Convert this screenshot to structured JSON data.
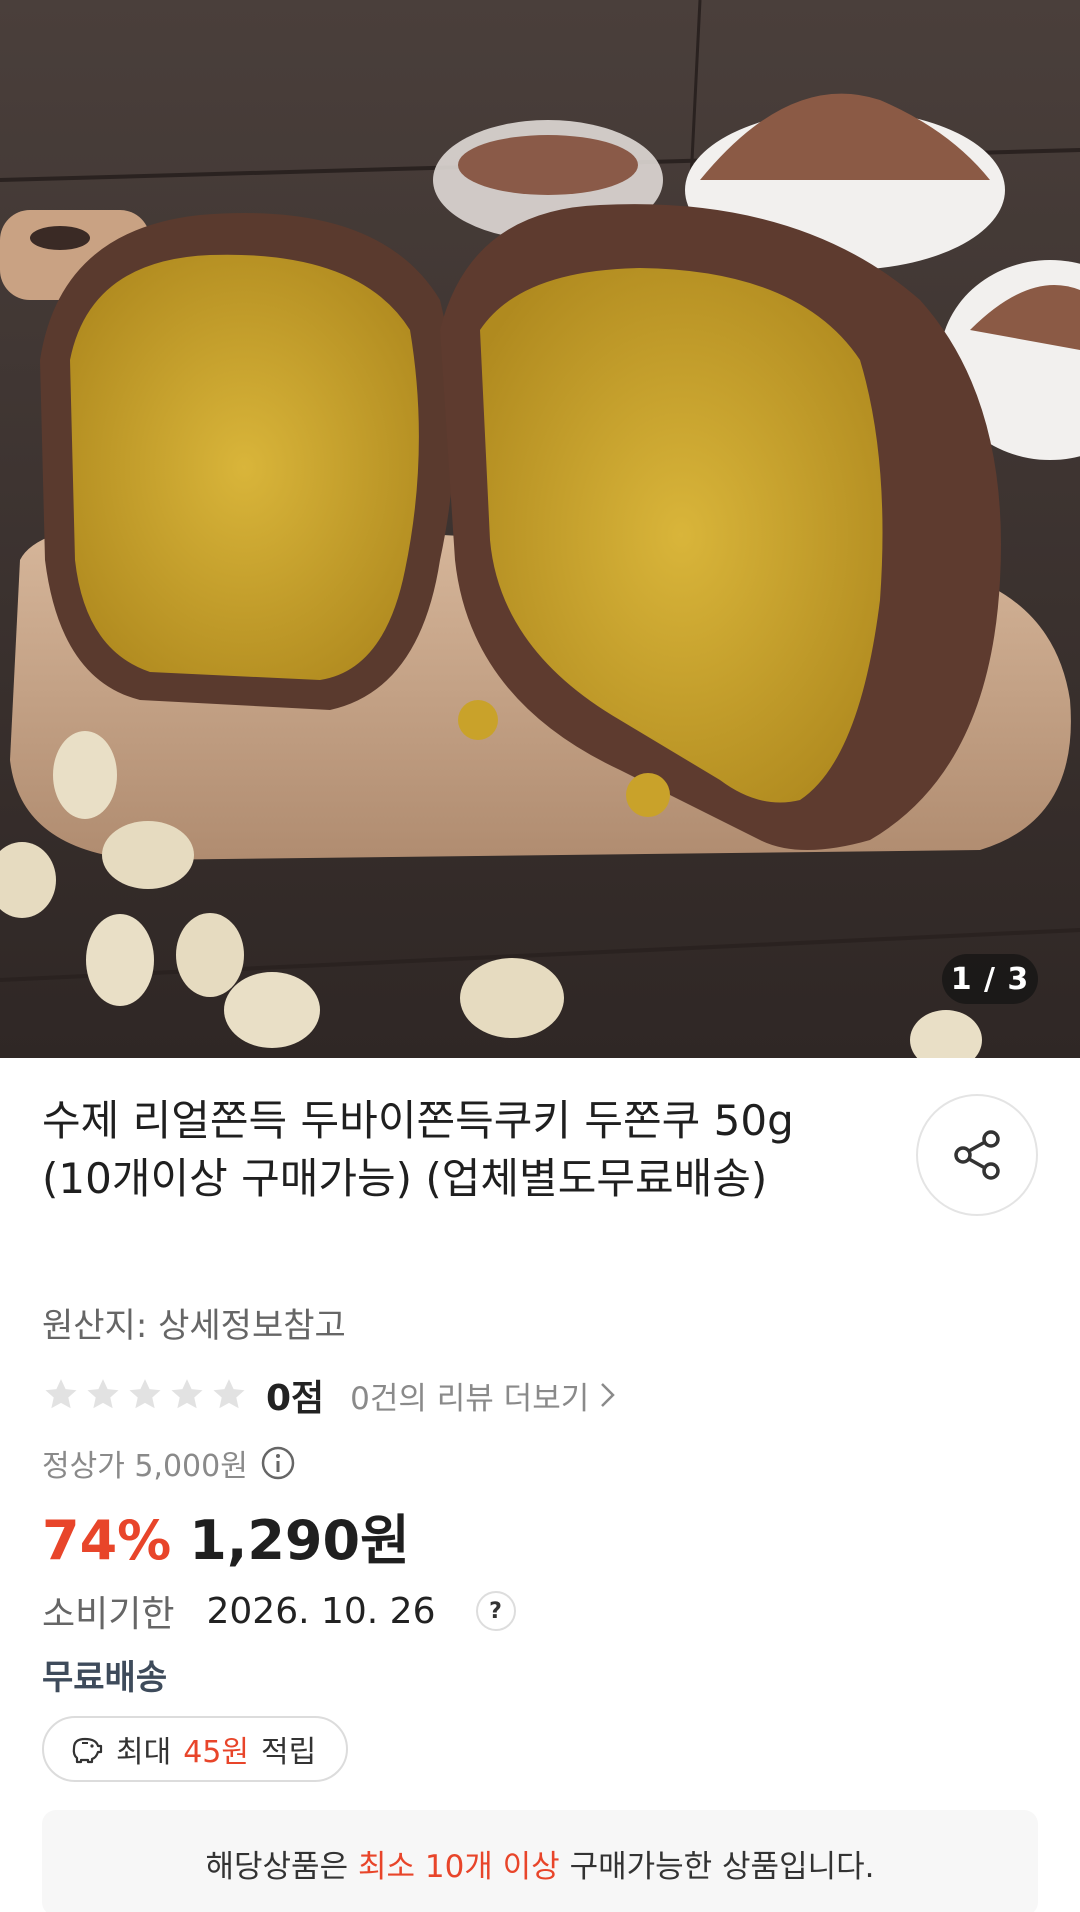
{
  "product": {
    "image_indicator": "1 / 3",
    "title": "수제 리얼쫀득 두바이쫀득쿠키 두쫀쿠 50g (10개이상 구매가능) (업체별도무료배송)",
    "origin": "원산지: 상세정보참고",
    "rating": {
      "stars_filled": 0,
      "stars_total": 5,
      "score_text": "0점",
      "review_link": "0건의 리뷰 더보기"
    },
    "regular_price": "정상가 5,000원",
    "discount": "74%",
    "sale_price": "1,290원",
    "expiry_label": "소비기한",
    "expiry_date": "2026. 10. 26",
    "expiry_help": "?",
    "shipping": "무료배송",
    "points": {
      "prefix": "최대",
      "amount": "45원",
      "suffix": "적립"
    },
    "notice": {
      "before": "해당상품은",
      "highlight": "최소 10개 이상",
      "after": "구매가능한 상품입니다."
    }
  },
  "icons": {
    "share": "share-icon",
    "star": "star-icon",
    "chevron": "chevron-right-icon",
    "info": "info-icon",
    "help": "question-icon",
    "points": "piggy-bank-icon"
  },
  "colors": {
    "accent": "#e8452a",
    "shipping": "#3e4b5b",
    "muted": "#8a8a8a",
    "star_empty": "#e2e2e2"
  }
}
